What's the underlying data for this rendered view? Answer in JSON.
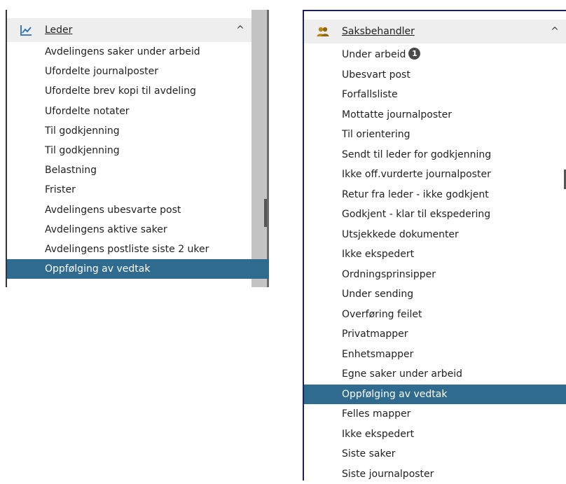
{
  "leder_panel": {
    "title": "Leder",
    "header_icon": "line-chart-icon",
    "chevron": "^",
    "items": [
      {
        "label": "Avdelingens saker under arbeid"
      },
      {
        "label": "Ufordelte journalposter"
      },
      {
        "label": "Ufordelte brev kopi til avdeling"
      },
      {
        "label": "Ufordelte notater"
      },
      {
        "label": "Til godkjenning"
      },
      {
        "label": "Til godkjenning"
      },
      {
        "label": "Belastning"
      },
      {
        "label": "Frister"
      },
      {
        "label": "Avdelingens ubesvarte post"
      },
      {
        "label": "Avdelingens aktive saker"
      },
      {
        "label": "Avdelingens postliste siste 2 uker"
      },
      {
        "label": "Oppfølging av vedtak",
        "active": true
      }
    ]
  },
  "saksbehandler_panel": {
    "title": "Saksbehandler",
    "header_icon": "users-icon",
    "chevron": "^",
    "items": [
      {
        "label": "Under arbeid",
        "badge": "1"
      },
      {
        "label": "Ubesvart post"
      },
      {
        "label": "Forfallsliste"
      },
      {
        "label": "Mottatte journalposter"
      },
      {
        "label": "Til orientering"
      },
      {
        "label": "Sendt til leder for godkjenning"
      },
      {
        "label": "Ikke off.vurderte journalposter"
      },
      {
        "label": "Retur fra leder - ikke godkjent"
      },
      {
        "label": "Godkjent - klar til ekspedering"
      },
      {
        "label": "Utsjekkede dokumenter"
      },
      {
        "label": "Ikke ekspedert"
      },
      {
        "label": "Ordningsprinsipper"
      },
      {
        "label": "Under sending"
      },
      {
        "label": "Overføring feilet"
      },
      {
        "label": "Privatmapper"
      },
      {
        "label": "Enhetsmapper"
      },
      {
        "label": "Egne saker under arbeid"
      },
      {
        "label": "Oppfølging av vedtak",
        "active": true
      },
      {
        "label": "Felles mapper"
      },
      {
        "label": "Ikke ekspedert"
      },
      {
        "label": "Siste saker"
      },
      {
        "label": "Siste journalposter"
      }
    ]
  },
  "colors": {
    "active_bg": "#2e6b8f",
    "header_bg": "#eeeeee",
    "icon_leder": "#2b6cb0",
    "icon_saks": "#b8860b"
  }
}
